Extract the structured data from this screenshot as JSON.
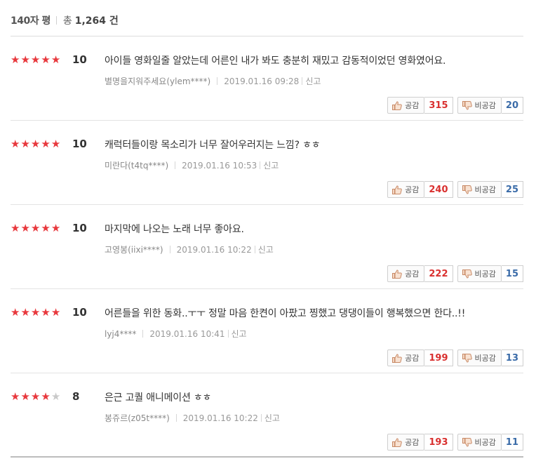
{
  "header": {
    "title": "140자 평",
    "total_label": "총",
    "total_count": "1,264 건"
  },
  "labels": {
    "like": "공감",
    "dislike": "비공감",
    "report": "신고"
  },
  "colors": {
    "star_filled": "#e8383d",
    "star_empty": "#c9c9c9",
    "like_count": "#d9302f",
    "dislike_count": "#3a6ba8"
  },
  "icons": [
    "star-icon",
    "thumbs-up-icon",
    "thumbs-down-icon"
  ],
  "reviews": [
    {
      "stars": 5,
      "score": "10",
      "comment": "아이들 영화일줄 알았는데 어른인 내가 봐도 충분히 재밌고 감동적이었던 영화였어요.",
      "user": "별명을지워주세요(ylem****)",
      "date": "2019.01.16 09:28",
      "likes": "315",
      "dislikes": "20"
    },
    {
      "stars": 5,
      "score": "10",
      "comment": "캐럭터들이랑 목소리가 너무 잘어우러지는 느낌? ㅎㅎ",
      "user": "미란다(t4tq****)",
      "date": "2019.01.16 10:53",
      "likes": "240",
      "dislikes": "25"
    },
    {
      "stars": 5,
      "score": "10",
      "comment": "마지막에 나오는 노래 너무 좋아요.",
      "user": "고영봉(iixi****)",
      "date": "2019.01.16 10:22",
      "likes": "222",
      "dislikes": "15"
    },
    {
      "stars": 5,
      "score": "10",
      "comment": "어른들을 위한 동화..ㅜㅜ 정말 마음 한켠이 아팠고 찡했고 댕댕이들이 행복했으면 한다..!!",
      "user": "lyj4****",
      "date": "2019.01.16 10:41",
      "likes": "199",
      "dislikes": "13"
    },
    {
      "stars": 4,
      "score": "8",
      "comment": "은근 고퀄 애니메이션 ㅎㅎ",
      "user": "봉쥬르(z05t****)",
      "date": "2019.01.16 10:22",
      "likes": "193",
      "dislikes": "11"
    }
  ]
}
